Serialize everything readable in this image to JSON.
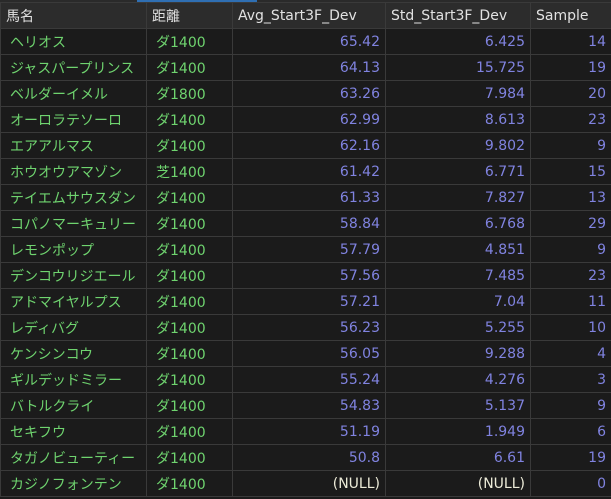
{
  "columns": [
    "馬名",
    "距離",
    "Avg_Start3F_Dev",
    "Std_Start3F_Dev",
    "Sample"
  ],
  "rows": [
    {
      "name": "ヘリオス",
      "dist": "ダ1400",
      "avg": "65.42",
      "std": "6.425",
      "sample": "14"
    },
    {
      "name": "ジャスパープリンス",
      "dist": "ダ1400",
      "avg": "64.13",
      "std": "15.725",
      "sample": "19"
    },
    {
      "name": "ベルダーイメル",
      "dist": "ダ1800",
      "avg": "63.26",
      "std": "7.984",
      "sample": "20"
    },
    {
      "name": "オーロラテソーロ",
      "dist": "ダ1400",
      "avg": "62.99",
      "std": "8.613",
      "sample": "23"
    },
    {
      "name": "エアアルマス",
      "dist": "ダ1400",
      "avg": "62.16",
      "std": "9.802",
      "sample": "9"
    },
    {
      "name": "ホウオウアマゾン",
      "dist": "芝1400",
      "avg": "61.42",
      "std": "6.771",
      "sample": "15"
    },
    {
      "name": "テイエムサウスダン",
      "dist": "ダ1400",
      "avg": "61.33",
      "std": "7.827",
      "sample": "13"
    },
    {
      "name": "コパノマーキュリー",
      "dist": "ダ1400",
      "avg": "58.84",
      "std": "6.768",
      "sample": "29"
    },
    {
      "name": "レモンポップ",
      "dist": "ダ1400",
      "avg": "57.79",
      "std": "4.851",
      "sample": "9"
    },
    {
      "name": "デンコウリジエール",
      "dist": "ダ1400",
      "avg": "57.56",
      "std": "7.485",
      "sample": "23"
    },
    {
      "name": "アドマイヤルプス",
      "dist": "ダ1400",
      "avg": "57.21",
      "std": "7.04",
      "sample": "11"
    },
    {
      "name": "レディバグ",
      "dist": "ダ1400",
      "avg": "56.23",
      "std": "5.255",
      "sample": "10"
    },
    {
      "name": "ケンシンコウ",
      "dist": "ダ1400",
      "avg": "56.05",
      "std": "9.288",
      "sample": "4"
    },
    {
      "name": "ギルデッドミラー",
      "dist": "ダ1400",
      "avg": "55.24",
      "std": "4.276",
      "sample": "3"
    },
    {
      "name": "バトルクライ",
      "dist": "ダ1400",
      "avg": "54.83",
      "std": "5.137",
      "sample": "9"
    },
    {
      "name": "セキフウ",
      "dist": "ダ1400",
      "avg": "51.19",
      "std": "1.949",
      "sample": "6"
    },
    {
      "name": "タガノビューティー",
      "dist": "ダ1400",
      "avg": "50.8",
      "std": "6.61",
      "sample": "19"
    },
    {
      "name": "カジノフォンテン",
      "dist": "ダ1400",
      "avg": "(NULL)",
      "std": "(NULL)",
      "sample": "0"
    }
  ],
  "colors": {
    "name_text": "#6fd46f",
    "number_text": "#8083e0",
    "null_text": "#ecebd8",
    "background": "#1b1b1b"
  }
}
